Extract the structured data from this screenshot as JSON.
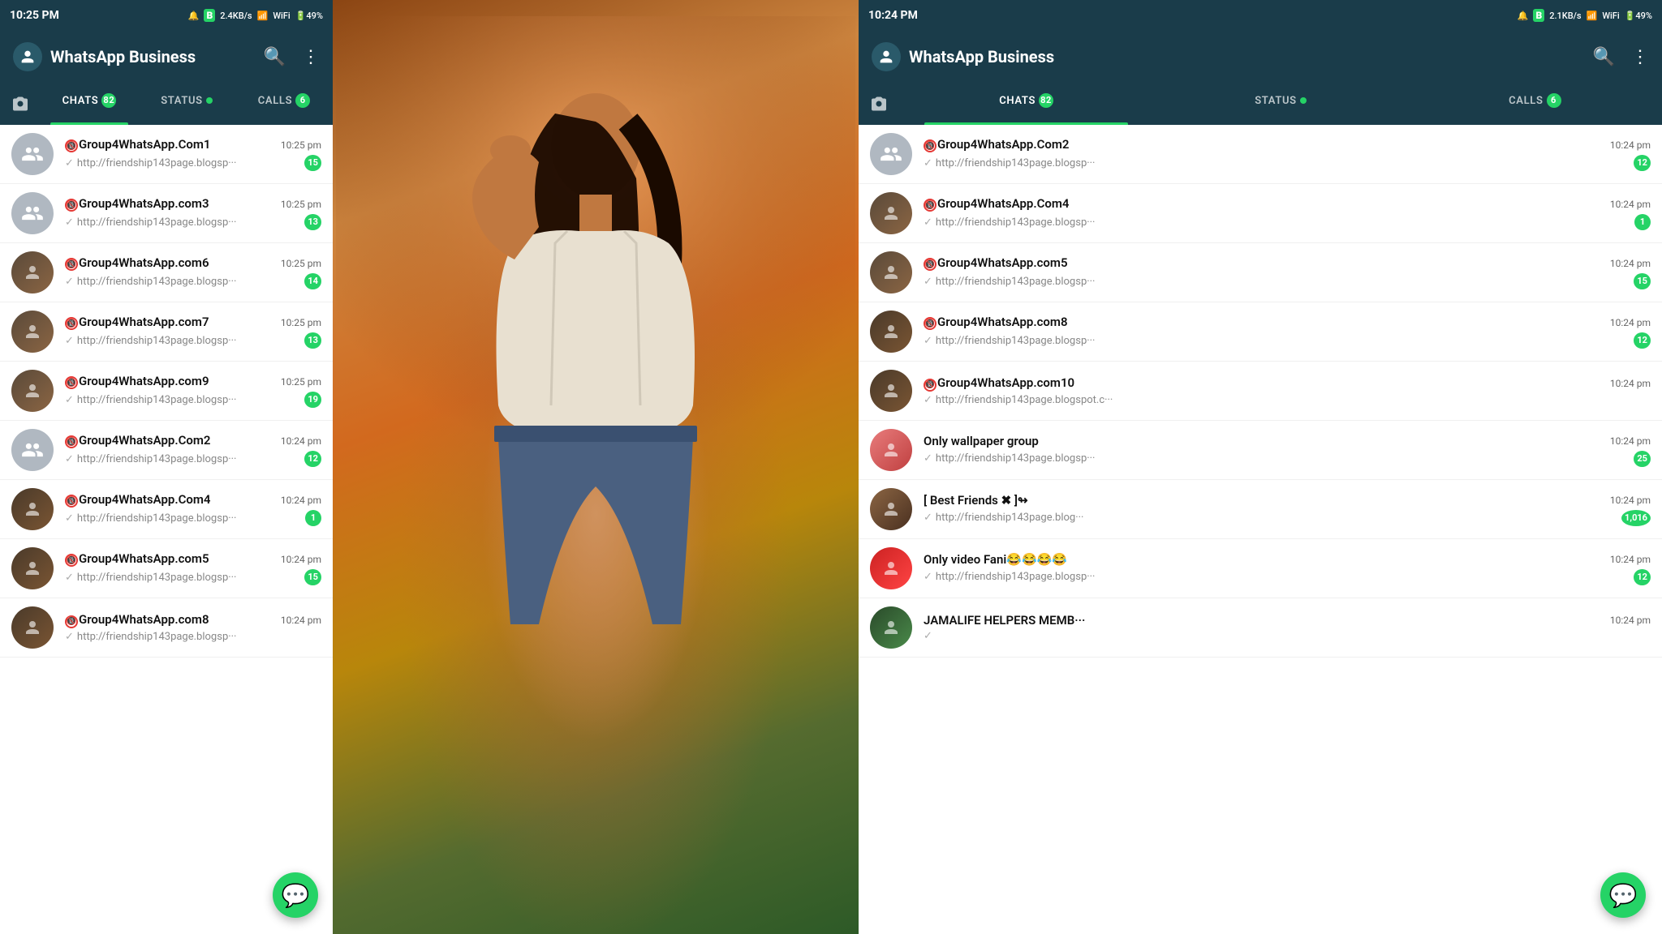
{
  "left_panel": {
    "status_bar": {
      "time": "10:25 PM",
      "network": "2.4KB/s",
      "signal": "4G",
      "wifi": "WiFi",
      "battery": "49"
    },
    "header": {
      "title": "WhatsApp Business",
      "search_label": "search",
      "menu_label": "menu"
    },
    "tabs": {
      "chats": {
        "label": "CHATS",
        "badge": "82"
      },
      "status": {
        "label": "STATUS"
      },
      "calls": {
        "label": "CALLS",
        "badge": "6"
      }
    },
    "chats": [
      {
        "id": 1,
        "name": "Group4WhatsApp.Com",
        "restricted": true,
        "number": "1",
        "time": "10:25 pm",
        "preview": "http://friendship143page.blogsp···",
        "unread": "15"
      },
      {
        "id": 2,
        "name": "Group4WhatsApp.com",
        "restricted": true,
        "number": "3",
        "time": "10:25 pm",
        "preview": "http://friendship143page.blogsp···",
        "unread": "13"
      },
      {
        "id": 3,
        "name": "Group4WhatsApp.com",
        "restricted": true,
        "number": "6",
        "time": "10:25 pm",
        "preview": "http://friendship143page.blogsp···",
        "unread": "14"
      },
      {
        "id": 4,
        "name": "Group4WhatsApp.com",
        "restricted": true,
        "number": "7",
        "time": "10:25 pm",
        "preview": "http://friendship143page.blogsp···",
        "unread": "13"
      },
      {
        "id": 5,
        "name": "Group4WhatsApp.com",
        "restricted": true,
        "number": "9",
        "time": "10:25 pm",
        "preview": "http://friendship143page.blogsp···",
        "unread": "19"
      },
      {
        "id": 6,
        "name": "Group4WhatsApp.Com",
        "restricted": true,
        "number": "2",
        "time": "10:24 pm",
        "preview": "http://friendship143page.blogsp···",
        "unread": "12"
      },
      {
        "id": 7,
        "name": "Group4WhatsApp.Com",
        "restricted": true,
        "number": "4",
        "time": "10:24 pm",
        "preview": "http://friendship143page.blogsp···",
        "unread": "1"
      },
      {
        "id": 8,
        "name": "Group4WhatsApp.com",
        "restricted": true,
        "number": "5",
        "time": "10:24 pm",
        "preview": "http://friendship143page.blogsp···",
        "unread": "15"
      },
      {
        "id": 9,
        "name": "Group4WhatsApp.com",
        "restricted": true,
        "number": "8",
        "time": "10:24 pm",
        "preview": "http://friendship143page.blogsp···",
        "unread": ""
      }
    ],
    "fab_label": "new chat"
  },
  "right_panel": {
    "status_bar": {
      "time": "10:24 PM",
      "network": "2.1KB/s",
      "signal": "4G",
      "wifi": "WiFi",
      "battery": "49"
    },
    "header": {
      "title": "WhatsApp Business",
      "search_label": "search",
      "menu_label": "menu"
    },
    "tabs": {
      "chats": {
        "label": "CHATS",
        "badge": "82"
      },
      "status": {
        "label": "STATUS"
      },
      "calls": {
        "label": "CALLS",
        "badge": "6"
      }
    },
    "chats": [
      {
        "id": 1,
        "name": "Group4WhatsApp.Com",
        "restricted": true,
        "number": "2",
        "time": "10:24 pm",
        "preview": "http://friendship143page.blogsp···",
        "unread": "12",
        "avatar_type": "group-gray"
      },
      {
        "id": 2,
        "name": "Group4WhatsApp.Com",
        "restricted": true,
        "number": "4",
        "time": "10:24 pm",
        "preview": "http://friendship143page.blogsp···",
        "unread": "1",
        "avatar_type": "tattoo1"
      },
      {
        "id": 3,
        "name": "Group4WhatsApp.com",
        "restricted": true,
        "number": "5",
        "time": "10:24 pm",
        "preview": "http://friendship143page.blogsp···",
        "unread": "15",
        "avatar_type": "tattoo1"
      },
      {
        "id": 4,
        "name": "Group4WhatsApp.com",
        "restricted": true,
        "number": "8",
        "time": "10:24 pm",
        "preview": "http://friendship143page.blogsp···",
        "unread": "12",
        "avatar_type": "tattoo2"
      },
      {
        "id": 5,
        "name": "Group4WhatsApp.com",
        "restricted": true,
        "number": "10",
        "time": "10:24 pm",
        "preview": "http://friendship143page.blogspot.c···",
        "unread": "",
        "avatar_type": "tattoo2"
      },
      {
        "id": 6,
        "name": "Only wallpaper group",
        "restricted": false,
        "number": "",
        "time": "10:24 pm",
        "preview": "http://friendship143page.blogsp···",
        "unread": "25",
        "avatar_type": "pink"
      },
      {
        "id": 7,
        "name": "఺ℂ[ ✖Best Friends ✖ ]↬",
        "restricted": false,
        "number": "",
        "time": "10:24 pm",
        "preview": "http://friendship143page.blog···",
        "unread": "1,016",
        "avatar_type": "bf"
      },
      {
        "id": 8,
        "name": "Only video Fani😂😂😂😂",
        "restricted": false,
        "number": "",
        "time": "10:24 pm",
        "preview": "http://friendship143page.blogsp···",
        "unread": "12",
        "avatar_type": "rose"
      },
      {
        "id": 9,
        "name": "JAMALIFE HELPERS MEMB···",
        "restricted": false,
        "number": "",
        "time": "10:24 pm",
        "preview": "",
        "unread": "",
        "avatar_type": "jamalife"
      }
    ],
    "fab_label": "new chat"
  }
}
